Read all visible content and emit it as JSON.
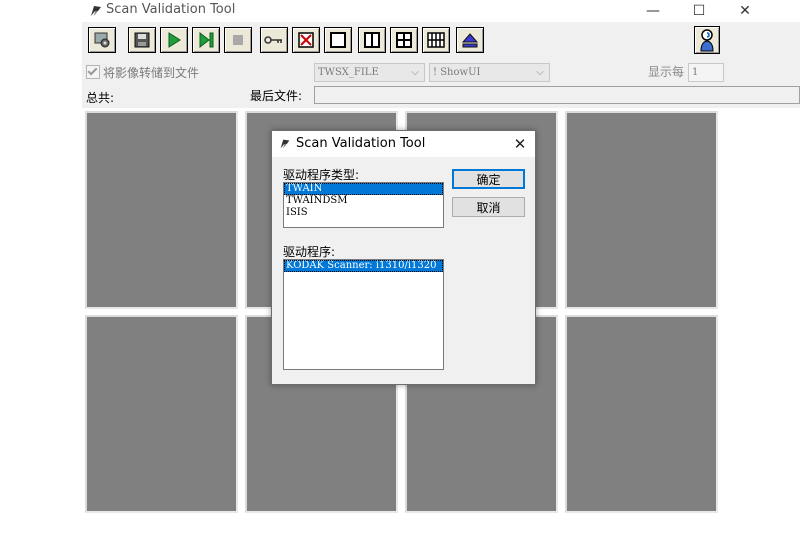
{
  "window": {
    "title": "Scan Validation Tool",
    "controls": {
      "minimize": "—",
      "maximize": "☐",
      "close": "✕"
    }
  },
  "toolbar": {
    "buttons": [
      {
        "name": "settings-button",
        "icon": "gear-icon"
      },
      {
        "name": "save-button",
        "icon": "floppy-icon"
      },
      {
        "name": "start-button",
        "icon": "play-icon"
      },
      {
        "name": "next-page-button",
        "icon": "step-forward-icon"
      },
      {
        "name": "stop-button",
        "icon": "stop-icon"
      },
      {
        "name": "key-button",
        "icon": "key-icon"
      },
      {
        "name": "no-view-button",
        "icon": "x-box-icon"
      },
      {
        "name": "view-1-button",
        "icon": "single-pane-icon"
      },
      {
        "name": "view-2-button",
        "icon": "two-pane-icon"
      },
      {
        "name": "view-4-button",
        "icon": "four-pane-icon"
      },
      {
        "name": "view-8-button",
        "icon": "eight-pane-icon"
      },
      {
        "name": "eject-button",
        "icon": "eject-icon"
      },
      {
        "name": "help-button",
        "icon": "help-person-icon"
      }
    ]
  },
  "options": {
    "save_images_label": "将影像转储到文件",
    "save_images_checked": true,
    "format_select": "TWSX_FILE",
    "ui_select": "! ShowUI",
    "show_each_label": "显示每",
    "show_each_value": "1"
  },
  "status": {
    "total_label": "总共:",
    "last_file_label": "最后文件:",
    "last_file_value": ""
  },
  "dialog": {
    "title": "Scan Validation Tool",
    "driver_type_label": "驱动程序类型:",
    "driver_types": [
      "TWAIN",
      "TWAINDSM",
      "ISIS"
    ],
    "selected_type_index": 0,
    "driver_label": "驱动程序:",
    "drivers": [
      "KODAK Scanner: i1310/i1320"
    ],
    "ok_label": "确定",
    "cancel_label": "取消"
  },
  "colors": {
    "accent": "#0078d7",
    "image_pane": "#808080",
    "play_green": "#1f9e3a",
    "eject_blue": "#3a3ad0"
  }
}
